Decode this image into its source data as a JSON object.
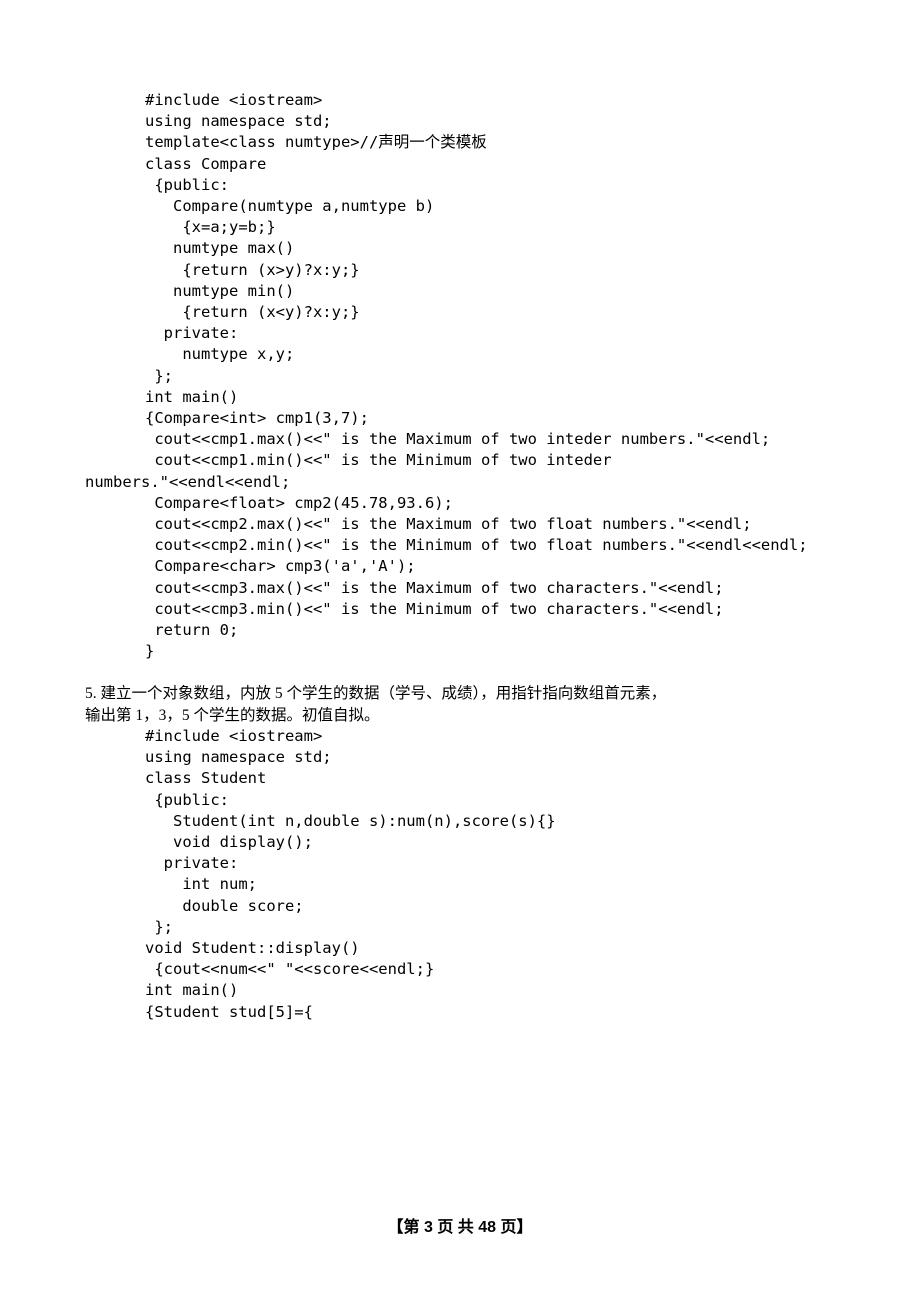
{
  "code1": {
    "l1": "#include <iostream>",
    "l2": "using namespace std;",
    "l3": "template<class numtype>//声明一个类模板",
    "l4": "class Compare",
    "l5": " {public:",
    "l6": "   Compare(numtype a,numtype b)",
    "l7": "    {x=a;y=b;}",
    "l8": "   numtype max()",
    "l9": "    {return (x>y)?x:y;}",
    "l10": "   numtype min()",
    "l11": "    {return (x<y)?x:y;}",
    "l12": "  private:",
    "l13": "    numtype x,y;",
    "l14": " };",
    "l15": "int main()",
    "l16": "{Compare<int> cmp1(3,7);",
    "l17": " cout<<cmp1.max()<<\" is the Maximum of two inteder numbers.\"<<endl;",
    "l18": " cout<<cmp1.min()<<\" is the Minimum of two inteder",
    "l18b": "numbers.\"<<endl<<endl;",
    "l19": " Compare<float> cmp2(45.78,93.6);",
    "l20": " cout<<cmp2.max()<<\" is the Maximum of two float numbers.\"<<endl;",
    "l21": " cout<<cmp2.min()<<\" is the Minimum of two float numbers.\"<<endl<<endl;",
    "l22": " Compare<char> cmp3('a','A');",
    "l23": " cout<<cmp3.max()<<\" is the Maximum of two characters.\"<<endl;",
    "l24": " cout<<cmp3.min()<<\" is the Minimum of two characters.\"<<endl;",
    "l25": " return 0;",
    "l26": "}"
  },
  "question5": {
    "line1": "5. 建立一个对象数组，内放 5 个学生的数据（学号、成绩），用指针指向数组首元素，",
    "line2": "输出第 1，3，5 个学生的数据。初值自拟。"
  },
  "code2": {
    "l1": "#include <iostream>",
    "l2": "using namespace std;",
    "l3": "class Student",
    "l4": " {public:",
    "l5": "   Student(int n,double s):num(n),score(s){}",
    "l6": "   void display();",
    "l7": "  private:",
    "l8": "    int num;",
    "l9": "    double score;",
    "l10": " };",
    "l11": "",
    "l12": "void Student::display()",
    "l13": " {cout<<num<<\" \"<<score<<endl;}",
    "l14": "",
    "l15": "int main()",
    "l16": "{Student stud[5]={"
  },
  "footer": "【第 3 页 共 48 页】"
}
